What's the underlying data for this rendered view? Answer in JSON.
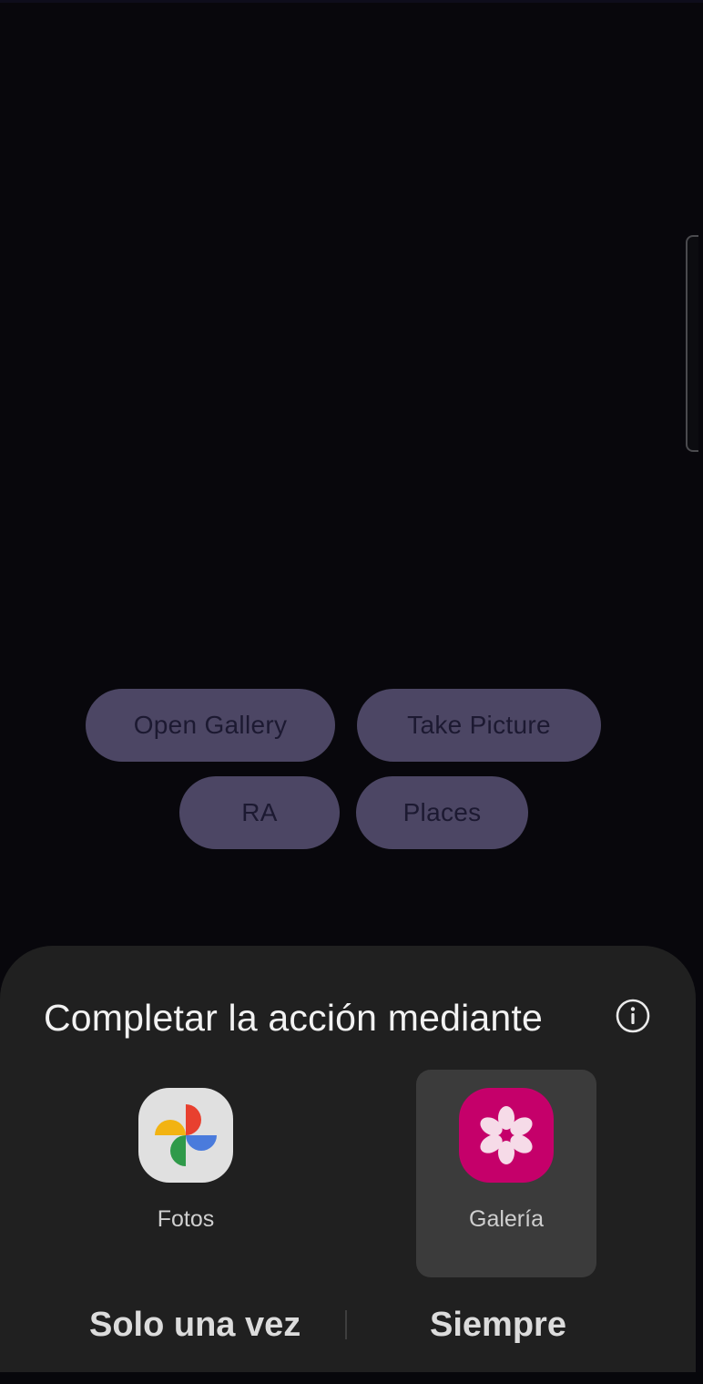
{
  "app_buttons": {
    "open_gallery": "Open Gallery",
    "take_picture": "Take Picture",
    "ra": "RA",
    "places": "Places"
  },
  "chooser": {
    "title": "Completar la acción mediante",
    "info_icon": "info-icon",
    "apps": [
      {
        "label": "Fotos",
        "icon": "google-photos-icon",
        "selected": false
      },
      {
        "label": "Galería",
        "icon": "gallery-flower-icon",
        "selected": true
      }
    ],
    "just_once_label": "Solo una vez",
    "always_label": "Siempre"
  },
  "colors": {
    "background": "#08070c",
    "pill_background": "#4c4664",
    "pill_text": "#1c1931",
    "sheet_background": "#202020",
    "selected_tile": "#3b3b3b",
    "galeria_icon": "#c5006a"
  }
}
